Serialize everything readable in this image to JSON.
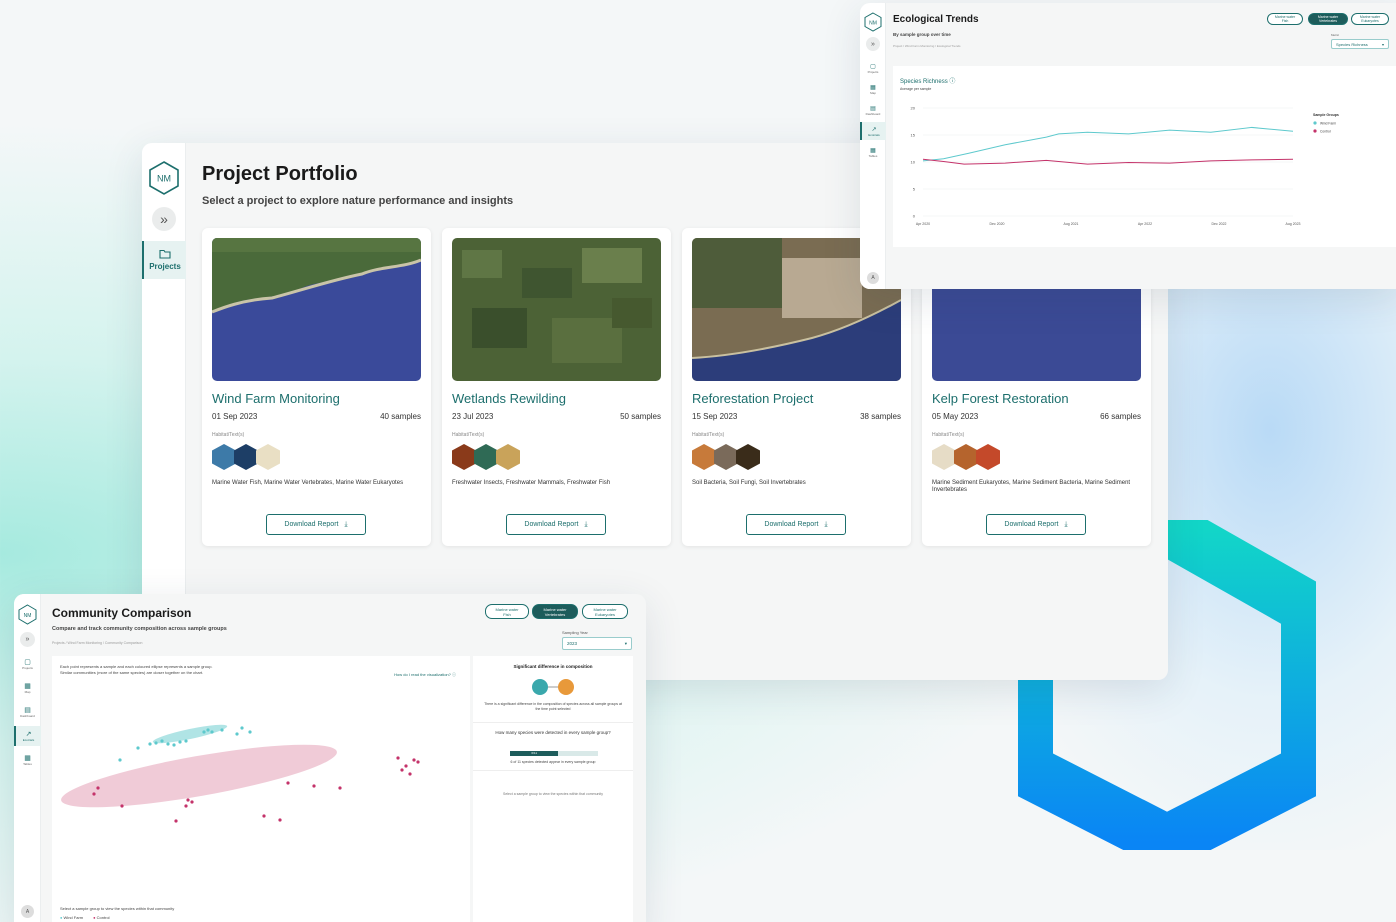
{
  "colors": {
    "accent": "#1d6f6d",
    "wind_farm": "#5ec9cd",
    "control": "#c4336a",
    "brand_hex_top": "#12d6c8",
    "brand_hex_bottom": "#0a85f5"
  },
  "brand": {
    "logo_text": "NM"
  },
  "portfolio": {
    "title": "Project Portfolio",
    "subtitle": "Select a project to explore nature performance and insights",
    "sidebar": {
      "collapse_icon": "double-chevron-right-icon",
      "items": [
        {
          "label": "Projects",
          "icon": "folder-icon"
        }
      ]
    },
    "habitat_label": "Habitat/Text(s)",
    "download_label": "Download Report",
    "cards": [
      {
        "title": "Wind Farm Monitoring",
        "date": "01 Sep 2023",
        "samples": "40 samples",
        "taxa": "Marine Water Fish, Marine Water Vertebrates, Marine Water Eukaryotes"
      },
      {
        "title": "Wetlands Rewilding",
        "date": "23 Jul 2023",
        "samples": "50 samples",
        "taxa": "Freshwater Insects, Freshwater Mammals, Freshwater Fish"
      },
      {
        "title": "Reforestation Project",
        "date": "15 Sep 2023",
        "samples": "38 samples",
        "taxa": "Soil Bacteria, Soil Fungi, Soil Invertebrates"
      },
      {
        "title": "Kelp Forest Restoration",
        "date": "05 May 2023",
        "samples": "66 samples",
        "taxa": "Marine Sediment Eukaryotes, Marine Sediment Bacteria, Marine Sediment Invertebrates"
      }
    ]
  },
  "trends": {
    "title": "Ecological Trends",
    "subtitle": "By sample group over time",
    "breadcrumb": "Project / Wind Farm Monitoring / Ecological Trends",
    "pills": [
      {
        "l1": "Marine water",
        "l2": "Fish"
      },
      {
        "l1": "Marine water",
        "l2": "Vertebrates"
      },
      {
        "l1": "Marine water",
        "l2": "Eukaryotes"
      }
    ],
    "metric_label": "Metric",
    "metric_value": "Species Richness",
    "nav": [
      "Projects",
      "Map",
      "Dashboard",
      "Ecotrials",
      "Tables"
    ],
    "avatar": "A"
  },
  "community": {
    "title": "Community Comparison",
    "subtitle": "Compare and track community composition across sample groups",
    "breadcrumb": "Projects / Wind Farm Monitoring / Community Comparison",
    "pills": [
      {
        "l1": "Marine water",
        "l2": "Fish"
      },
      {
        "l1": "Marine water",
        "l2": "Vertebrates"
      },
      {
        "l1": "Marine water",
        "l2": "Eukaryotes"
      }
    ],
    "year_label": "Sampling Year",
    "year_value": "2023",
    "desc1": "Each point represents a sample and each coloured ellipse represents a sample group.",
    "desc2": "Similar communities (more of the same species) are closer together on the chart.",
    "help_link": "How do I read the visualization?",
    "footer": "Select a sample group to view the species within that community",
    "legend": [
      "Wind Farm",
      "Control"
    ],
    "right": {
      "sig_title": "Significant difference in composition",
      "sig_text": "There is a significant difference in the composition of species across all sample groups at the time point selected",
      "q": "How many species were detected in every sample group?",
      "bar_label": "6/11",
      "bar_fraction": 0.55,
      "bar_text": "6 of 11 species detected appear in every sample group",
      "hint": "Select a sample group to view the species within that community"
    },
    "nav": [
      "Projects",
      "Map",
      "Dashboard",
      "Ecotrials",
      "Tables"
    ],
    "avatar": "A"
  },
  "chart_data": {
    "type": "line",
    "title": "Species Richness",
    "subtitle": "Average per sample",
    "x": [
      "Apr 2020",
      "Dec 2020",
      "Aug 2021",
      "Apr 2022",
      "Dec 2022",
      "Aug 2023"
    ],
    "xlabel": "",
    "ylabel": "",
    "yticks": [
      0,
      5,
      10,
      15,
      20
    ],
    "ylim": [
      0,
      20
    ],
    "legend_title": "Sample Groups",
    "legend_position": "right",
    "series": [
      {
        "name": "Wind Farm",
        "color": "#5ec9cd",
        "points": [
          [
            0,
            10.2
          ],
          [
            0.5,
            10.6
          ],
          [
            1.1,
            11.6
          ],
          [
            2,
            13.2
          ],
          [
            3,
            14.6
          ],
          [
            3.3,
            15.2
          ],
          [
            4,
            15.5
          ],
          [
            5,
            15.2
          ],
          [
            6,
            15.9
          ],
          [
            7,
            15.5
          ],
          [
            8,
            16.4
          ],
          [
            9,
            15.7
          ]
        ]
      },
      {
        "name": "Control",
        "color": "#c4336a",
        "points": [
          [
            0,
            10.5
          ],
          [
            0.5,
            10.1
          ],
          [
            1,
            9.6
          ],
          [
            2,
            9.8
          ],
          [
            3,
            10.3
          ],
          [
            4,
            9.6
          ],
          [
            5,
            9.9
          ],
          [
            6,
            9.8
          ],
          [
            7,
            10.2
          ],
          [
            8,
            10.4
          ],
          [
            9,
            10.5
          ]
        ]
      }
    ]
  }
}
